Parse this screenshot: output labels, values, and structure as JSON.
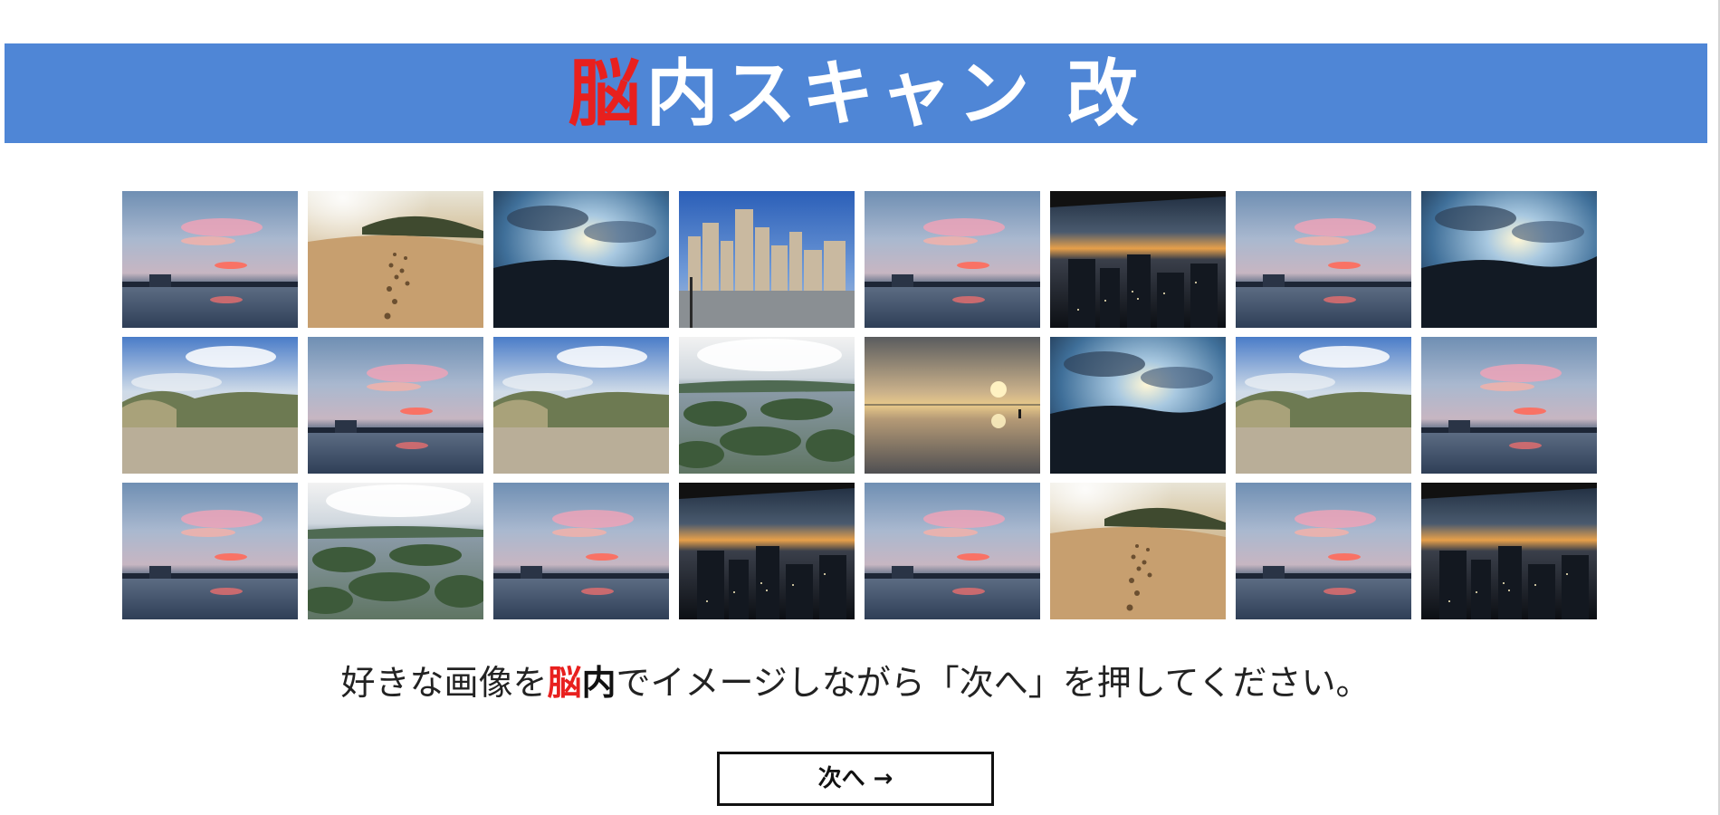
{
  "header": {
    "title_accent": "脳",
    "title_rest": "内スキャン 改",
    "background_color": "#4f86d6",
    "accent_color": "#e8201e"
  },
  "thumbnails": [
    {
      "scene": "pink-sunset-lake",
      "alt": "pink sunset over lake"
    },
    {
      "scene": "sand-dune-footprints",
      "alt": "footprints on sand dune"
    },
    {
      "scene": "sunburst-clouds-hills",
      "alt": "sunburst through clouds over hills"
    },
    {
      "scene": "city-skyline",
      "alt": "city skyline with blue sky"
    },
    {
      "scene": "pink-sunset-lake",
      "alt": "pink sunset over lake"
    },
    {
      "scene": "night-city-sunset",
      "alt": "city at dusk from window"
    },
    {
      "scene": "pink-sunset-lake",
      "alt": "pink sunset over lake"
    },
    {
      "scene": "sunburst-clouds-hills",
      "alt": "sunburst through clouds over hills"
    },
    {
      "scene": "mountain-valley",
      "alt": "mountain valley with clouds"
    },
    {
      "scene": "pink-sunset-lake",
      "alt": "pink sunset over lake"
    },
    {
      "scene": "mountain-valley",
      "alt": "mountain valley with clouds"
    },
    {
      "scene": "lake-islands",
      "alt": "lake with green islands"
    },
    {
      "scene": "beach-reflection-sunset",
      "alt": "sunset reflected on beach"
    },
    {
      "scene": "sunburst-clouds-hills",
      "alt": "sunburst through clouds over hills"
    },
    {
      "scene": "mountain-valley",
      "alt": "mountain valley with clouds"
    },
    {
      "scene": "pink-sunset-lake",
      "alt": "pink sunset over lake"
    },
    {
      "scene": "pink-sunset-lake",
      "alt": "pink sunset over lake"
    },
    {
      "scene": "lake-islands",
      "alt": "lake with green islands"
    },
    {
      "scene": "pink-sunset-lake",
      "alt": "pink sunset over lake"
    },
    {
      "scene": "night-city-sunset",
      "alt": "city at dusk from window"
    },
    {
      "scene": "pink-sunset-lake",
      "alt": "pink sunset over lake"
    },
    {
      "scene": "sand-dune-footprints",
      "alt": "footprints on sand dune"
    },
    {
      "scene": "pink-sunset-lake",
      "alt": "pink sunset over lake"
    },
    {
      "scene": "night-city-sunset",
      "alt": "city at dusk from window"
    }
  ],
  "instruction": {
    "part1": "好きな画像を",
    "accent_red": "脳",
    "accent_black": "内",
    "part2": "でイメージしながら「次へ」を押してください。"
  },
  "next_button": {
    "label": "次へ →"
  }
}
